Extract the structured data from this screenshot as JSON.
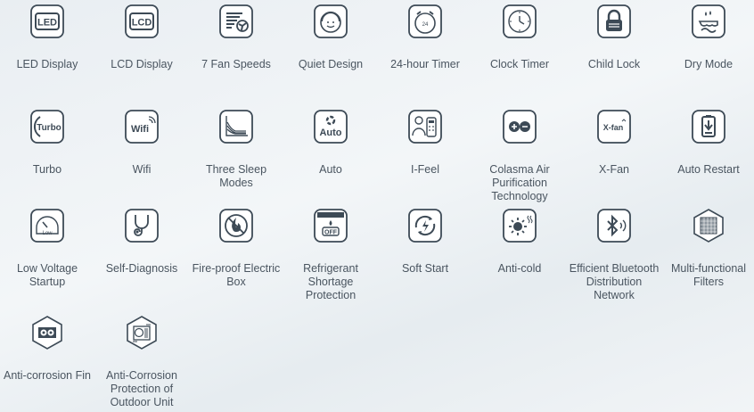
{
  "features": [
    {
      "icon": "led-icon",
      "label": "LED Display"
    },
    {
      "icon": "lcd-icon",
      "label": "LCD Display"
    },
    {
      "icon": "fan-speeds-icon",
      "label": "7 Fan Speeds"
    },
    {
      "icon": "quiet-icon",
      "label": "Quiet Design"
    },
    {
      "icon": "timer-24-icon",
      "label": "24-hour Timer"
    },
    {
      "icon": "clock-icon",
      "label": "Clock Timer"
    },
    {
      "icon": "lock-icon",
      "label": "Child Lock"
    },
    {
      "icon": "dry-icon",
      "label": "Dry Mode"
    },
    {
      "icon": "turbo-icon",
      "label": "Turbo"
    },
    {
      "icon": "wifi-icon",
      "label": "Wifi"
    },
    {
      "icon": "sleep-icon",
      "label": "Three Sleep Modes"
    },
    {
      "icon": "auto-icon",
      "label": "Auto"
    },
    {
      "icon": "ifeel-icon",
      "label": "I-Feel"
    },
    {
      "icon": "colasma-icon",
      "label": "Colasma Air Purification Technology"
    },
    {
      "icon": "xfan-icon",
      "label": "X-Fan"
    },
    {
      "icon": "restart-icon",
      "label": "Auto Restart"
    },
    {
      "icon": "low-voltage-icon",
      "label": "Low Voltage Startup"
    },
    {
      "icon": "diagnosis-icon",
      "label": "Self-Diagnosis"
    },
    {
      "icon": "fireproof-icon",
      "label": "Fire-proof Electric Box"
    },
    {
      "icon": "refrigerant-icon",
      "label": "Refrigerant Shortage Protection"
    },
    {
      "icon": "soft-start-icon",
      "label": "Soft Start"
    },
    {
      "icon": "anticold-icon",
      "label": "Anti-cold"
    },
    {
      "icon": "bluetooth-icon",
      "label": "Efficient Bluetooth Distribution Network"
    },
    {
      "icon": "filter-icon",
      "label": "Multi-functional Filters"
    },
    {
      "icon": "fin-icon",
      "label": "Anti-corrosion Fin"
    },
    {
      "icon": "outdoor-icon",
      "label": "Anti-Corrosion Protection of Outdoor Unit"
    }
  ],
  "icon_texts": {
    "led": "LED",
    "lcd": "LCD",
    "turbo": "Turbo",
    "wifi": "Wifi",
    "auto": "Auto",
    "xfan": "X-fan",
    "low": "Low",
    "off": "OFF",
    "h24": "24"
  }
}
